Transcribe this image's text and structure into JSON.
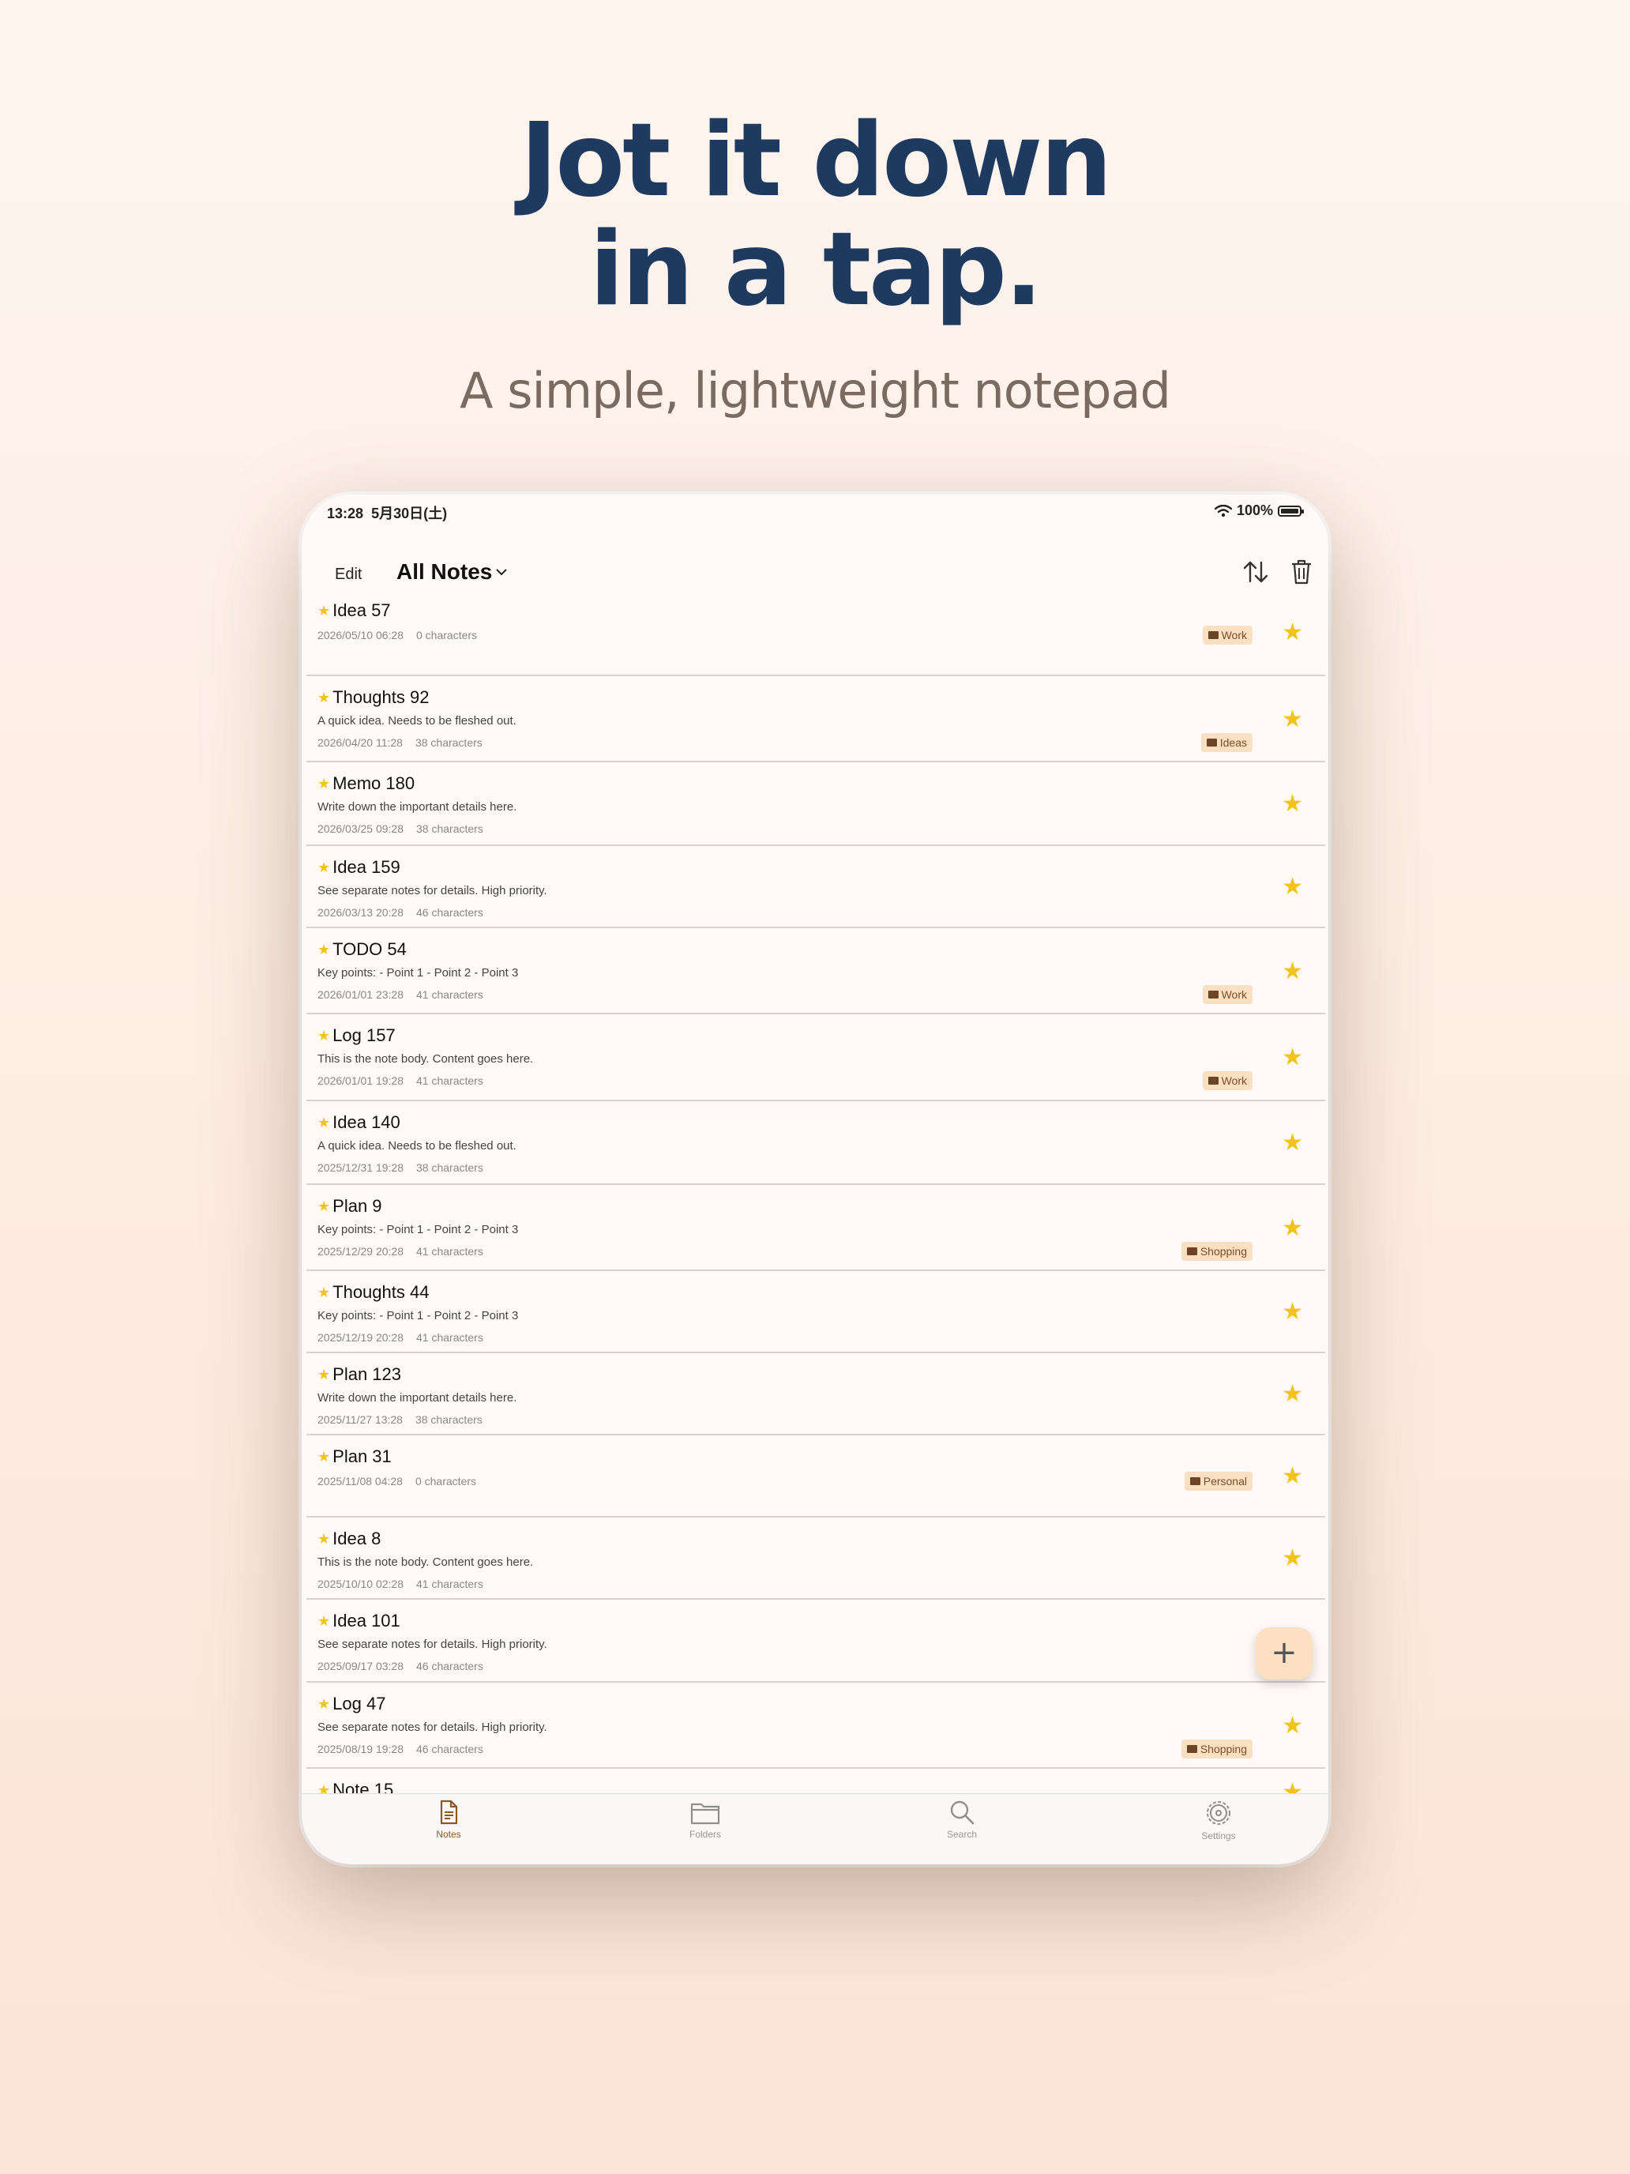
{
  "headline": {
    "line1": "Jot it down",
    "line2": "in a tap."
  },
  "subheadline": "A simple, lightweight notepad",
  "status_bar": {
    "time": "13:28",
    "date": "5月30日(土)",
    "battery": "100%"
  },
  "nav": {
    "edit_label": "Edit",
    "title": "All Notes"
  },
  "notes": [
    {
      "title": "Idea 57",
      "preview": "",
      "date": "2026/05/10 06:28",
      "chars": "0 characters",
      "folder": "Work"
    },
    {
      "title": "Thoughts 92",
      "preview": "A quick idea. Needs to be fleshed out.",
      "date": "2026/04/20 11:28",
      "chars": "38 characters",
      "folder": "Ideas"
    },
    {
      "title": "Memo 180",
      "preview": "Write down the important details here.",
      "date": "2026/03/25 09:28",
      "chars": "38 characters",
      "folder": ""
    },
    {
      "title": "Idea 159",
      "preview": "See separate notes for details. High priority.",
      "date": "2026/03/13 20:28",
      "chars": "46 characters",
      "folder": ""
    },
    {
      "title": "TODO 54",
      "preview": "Key points: - Point 1 - Point 2 - Point 3",
      "date": "2026/01/01 23:28",
      "chars": "41 characters",
      "folder": "Work"
    },
    {
      "title": "Log 157",
      "preview": "This is the note body. Content goes here.",
      "date": "2026/01/01 19:28",
      "chars": "41 characters",
      "folder": "Work"
    },
    {
      "title": "Idea 140",
      "preview": "A quick idea. Needs to be fleshed out.",
      "date": "2025/12/31 19:28",
      "chars": "38 characters",
      "folder": ""
    },
    {
      "title": "Plan 9",
      "preview": "Key points: - Point 1 - Point 2 - Point 3",
      "date": "2025/12/29 20:28",
      "chars": "41 characters",
      "folder": "Shopping"
    },
    {
      "title": "Thoughts 44",
      "preview": "Key points: - Point 1 - Point 2 - Point 3",
      "date": "2025/12/19 20:28",
      "chars": "41 characters",
      "folder": ""
    },
    {
      "title": "Plan 123",
      "preview": "Write down the important details here.",
      "date": "2025/11/27 13:28",
      "chars": "38 characters",
      "folder": ""
    },
    {
      "title": "Plan 31",
      "preview": "",
      "date": "2025/11/08 04:28",
      "chars": "0 characters",
      "folder": "Personal"
    },
    {
      "title": "Idea 8",
      "preview": "This is the note body. Content goes here.",
      "date": "2025/10/10 02:28",
      "chars": "41 characters",
      "folder": ""
    },
    {
      "title": "Idea 101",
      "preview": "See separate notes for details. High priority.",
      "date": "2025/09/17 03:28",
      "chars": "46 characters",
      "folder": ""
    },
    {
      "title": "Log 47",
      "preview": "See separate notes for details. High priority.",
      "date": "2025/08/19 19:28",
      "chars": "46 characters",
      "folder": "Shopping"
    },
    {
      "title": "Note 15",
      "preview": "",
      "date": "",
      "chars": "",
      "folder": ""
    }
  ],
  "fab_label": "+",
  "tabs": [
    {
      "label": "Notes",
      "icon": "note-icon",
      "active": true
    },
    {
      "label": "Folders",
      "icon": "folder-icon",
      "active": false
    },
    {
      "label": "Search",
      "icon": "search-icon",
      "active": false
    },
    {
      "label": "Settings",
      "icon": "gear-icon",
      "active": false
    }
  ],
  "colors": {
    "accent": "#8a5a22",
    "star": "#f2c31a",
    "tag_bg": "#fadfc0",
    "headline": "#1f3a5f"
  }
}
